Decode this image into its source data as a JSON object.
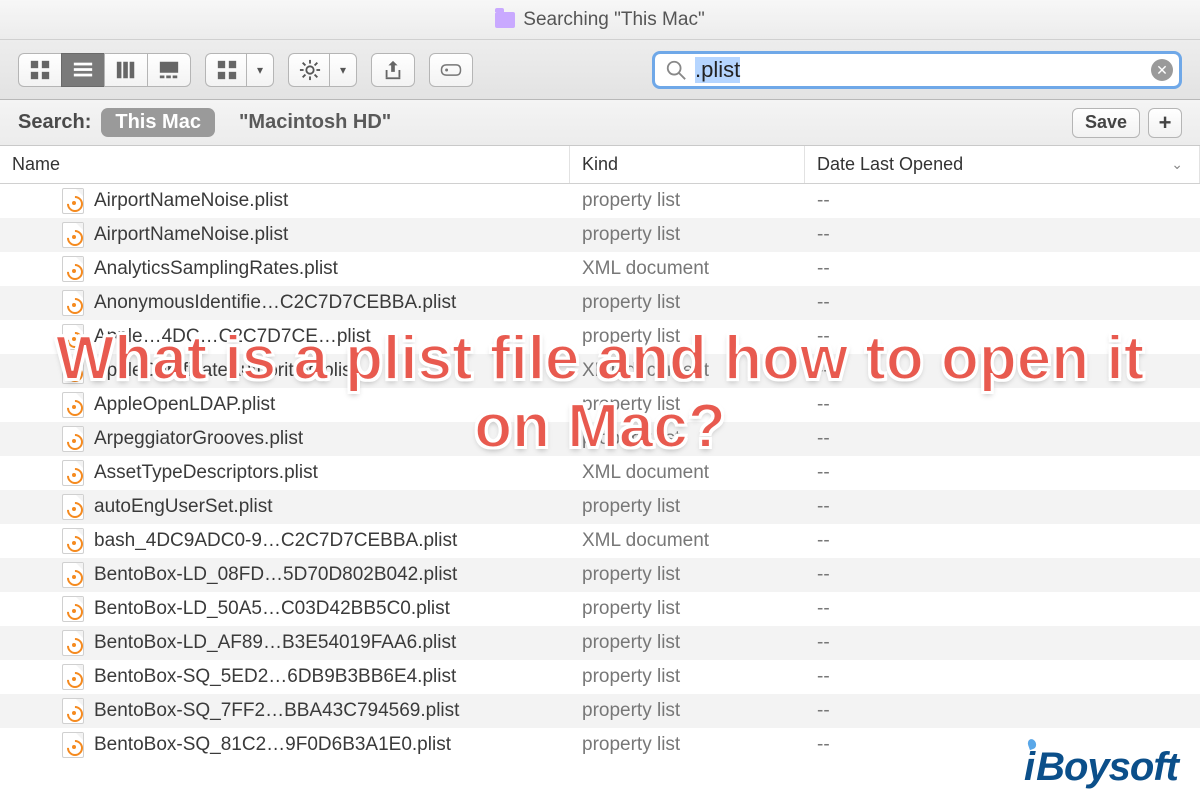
{
  "window": {
    "title": "Searching \"This Mac\""
  },
  "toolbar": {
    "view_icon_mode": "icon-view",
    "view_list_mode": "list-view",
    "view_column_mode": "column-view",
    "view_gallery_mode": "gallery-view",
    "arrange_menu": "arrange",
    "action_menu": "action",
    "share": "share",
    "tags": "edit-tags"
  },
  "search": {
    "value": ".plist",
    "placeholder": "Search",
    "clear_label": "clear"
  },
  "scopebar": {
    "label": "Search:",
    "scopes": [
      {
        "label": "This Mac",
        "active": true
      },
      {
        "label": "\"Macintosh HD\"",
        "active": false
      }
    ],
    "save_label": "Save",
    "add_label": "+"
  },
  "columns": {
    "name": "Name",
    "kind": "Kind",
    "date": "Date Last Opened"
  },
  "rows": [
    {
      "name": "AirportNameNoise.plist",
      "kind": "property list",
      "date": "--"
    },
    {
      "name": "AirportNameNoise.plist",
      "kind": "property list",
      "date": "--"
    },
    {
      "name": "AnalyticsSamplingRates.plist",
      "kind": "XML document",
      "date": "--"
    },
    {
      "name": "AnonymousIdentifie…C2C7D7CEBBA.plist",
      "kind": "property list",
      "date": "--"
    },
    {
      "name": "Apple…4DC…C2C7D7CE…plist",
      "kind": "property list",
      "date": "--"
    },
    {
      "name": "AppleCertificateAuthorities.plist",
      "kind": "XML document",
      "date": "--"
    },
    {
      "name": "AppleOpenLDAP.plist",
      "kind": "property list",
      "date": "--"
    },
    {
      "name": "ArpeggiatorGrooves.plist",
      "kind": "property list",
      "date": "--"
    },
    {
      "name": "AssetTypeDescriptors.plist",
      "kind": "XML document",
      "date": "--"
    },
    {
      "name": "autoEngUserSet.plist",
      "kind": "property list",
      "date": "--"
    },
    {
      "name": "bash_4DC9ADC0-9…C2C7D7CEBBA.plist",
      "kind": "XML document",
      "date": "--"
    },
    {
      "name": "BentoBox-LD_08FD…5D70D802B042.plist",
      "kind": "property list",
      "date": "--"
    },
    {
      "name": "BentoBox-LD_50A5…C03D42BB5C0.plist",
      "kind": "property list",
      "date": "--"
    },
    {
      "name": "BentoBox-LD_AF89…B3E54019FAA6.plist",
      "kind": "property list",
      "date": "--"
    },
    {
      "name": "BentoBox-SQ_5ED2…6DB9B3BB6E4.plist",
      "kind": "property list",
      "date": "--"
    },
    {
      "name": "BentoBox-SQ_7FF2…BBA43C794569.plist",
      "kind": "property list",
      "date": "--"
    },
    {
      "name": "BentoBox-SQ_81C2…9F0D6B3A1E0.plist",
      "kind": "property list",
      "date": "--"
    }
  ],
  "overlay": {
    "headline": "What is a plist file and how to open it on Mac?"
  },
  "watermark": {
    "text": "iBoysoft"
  }
}
